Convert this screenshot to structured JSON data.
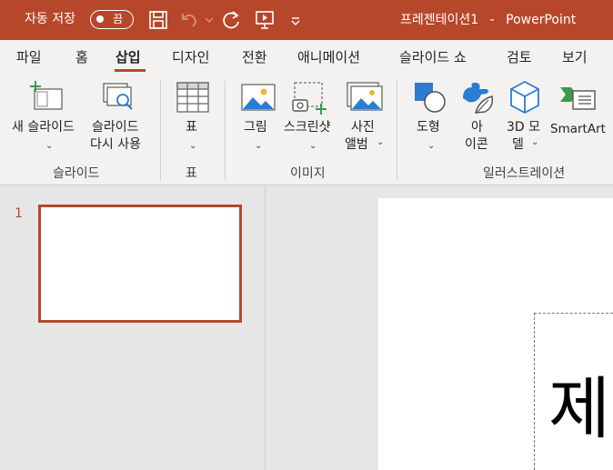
{
  "titlebar": {
    "autosave_label": "자동 저장",
    "autosave_state": "끔",
    "document_title": "프레젠테이션1",
    "app_name": "PowerPoint",
    "title_separator": "-"
  },
  "tabs": [
    {
      "label": "파일"
    },
    {
      "label": "홈"
    },
    {
      "label": "삽입",
      "active": true
    },
    {
      "label": "디자인"
    },
    {
      "label": "전환"
    },
    {
      "label": "애니메이션"
    },
    {
      "label": "슬라이드 쇼"
    },
    {
      "label": "검토"
    },
    {
      "label": "보기"
    }
  ],
  "ribbon": {
    "new_slide": "새 슬라이드",
    "reuse_slides_1": "슬라이드",
    "reuse_slides_2": "다시 사용",
    "table": "표",
    "pictures": "그림",
    "screenshot": "스크린샷",
    "photo_album_1": "사진",
    "photo_album_2": "앨범",
    "shapes": "도형",
    "icons_1": "아",
    "icons_2": "이콘",
    "models_1": "3D 모",
    "models_2": "델",
    "smartart": "SmartArt",
    "groups": {
      "slides": "슬라이드",
      "tables": "표",
      "images": "이미지",
      "illustrations": "일러스트레이션"
    }
  },
  "slides": {
    "number": "1",
    "canvas_text": "제"
  },
  "colors": {
    "accent": "#b7472a",
    "ribbon_bg": "#f3f2f1",
    "workspace_bg": "#e6e6e6"
  }
}
